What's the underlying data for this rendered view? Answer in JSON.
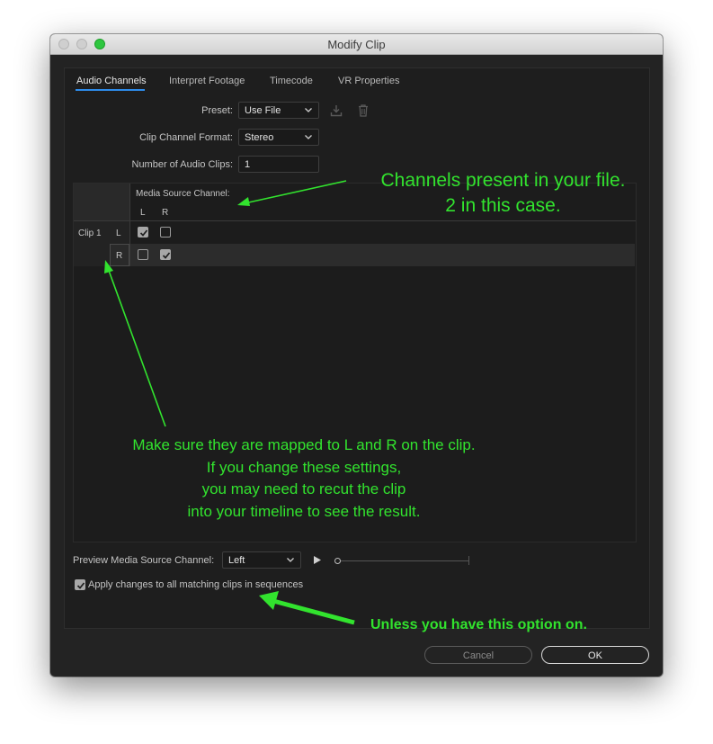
{
  "window": {
    "title": "Modify Clip",
    "tabs": [
      "Audio Channels",
      "Interpret Footage",
      "Timecode",
      "VR Properties"
    ],
    "active_tab": "Audio Channels"
  },
  "form": {
    "preset_label": "Preset:",
    "preset_value": "Use File",
    "format_label": "Clip Channel Format:",
    "format_value": "Stereo",
    "num_clips_label": "Number of Audio Clips:",
    "num_clips_value": "1"
  },
  "grid": {
    "header_title": "Media Source Channel:",
    "source_channels": [
      "L",
      "R"
    ],
    "clip_name": "Clip 1",
    "rows": [
      {
        "channel": "L",
        "checks": [
          true,
          false
        ]
      },
      {
        "channel": "R",
        "checks": [
          false,
          true
        ]
      }
    ]
  },
  "preview": {
    "label": "Preview Media Source Channel:",
    "value": "Left",
    "progress": 0
  },
  "apply": {
    "label": "Apply changes to all matching clips in sequences",
    "checked": true
  },
  "buttons": {
    "cancel": "Cancel",
    "ok": "OK"
  },
  "annotations": {
    "channels_line1": "Channels present in your file.",
    "channels_line2": "2 in this case.",
    "mapped_line1": "Make sure they are mapped to L and R on the clip.",
    "mapped_line2": "If you change these settings,",
    "mapped_line3": "you may need to recut the clip",
    "mapped_line4": "into your timeline to see the result.",
    "option": "Unless you have this option on."
  },
  "colors": {
    "annotation": "#32e32e",
    "tab_accent": "#2d8ceb",
    "dialog_bg": "#232323"
  }
}
